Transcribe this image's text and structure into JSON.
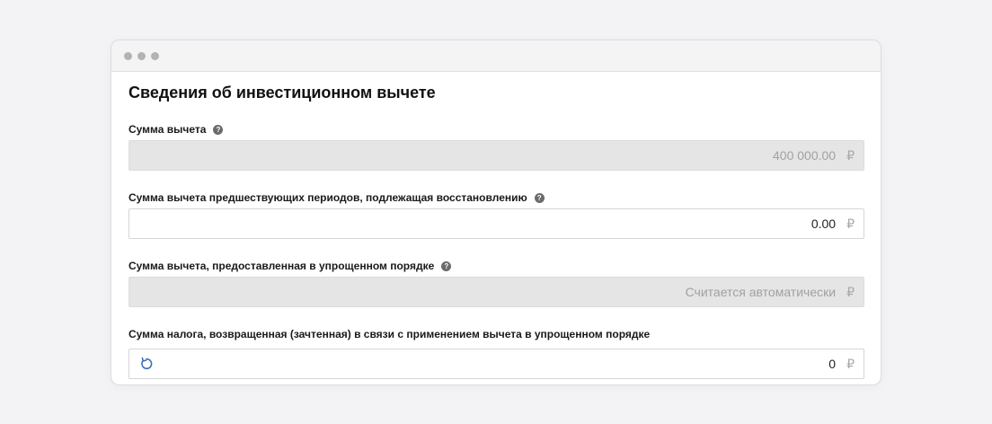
{
  "colors": {
    "disabled_field_bg": "#e5e5e6",
    "accent_icon": "#3c6fb5",
    "window_bg": "#ffffff"
  },
  "form": {
    "title": "Сведения об инвестиционном вычете",
    "fields": [
      {
        "label": "Сумма вычета",
        "value": "400 000.00",
        "currency": "₽",
        "help": "?",
        "disabled": true
      },
      {
        "label": "Сумма вычета предшествующих периодов, подлежащая восстановлению",
        "value": "0.00",
        "currency": "₽",
        "help": "?",
        "disabled": false
      },
      {
        "label": "Сумма вычета, предоставленная в упрощенном порядке",
        "value": "Считается автоматически",
        "currency": "₽",
        "help": "?",
        "disabled": true
      },
      {
        "label": "Сумма налога, возвращенная (зачтенная) в связи с применением вычета в упрощенном порядке",
        "value": "0",
        "currency": "₽",
        "disabled": false,
        "icon": "reset-icon"
      }
    ]
  }
}
